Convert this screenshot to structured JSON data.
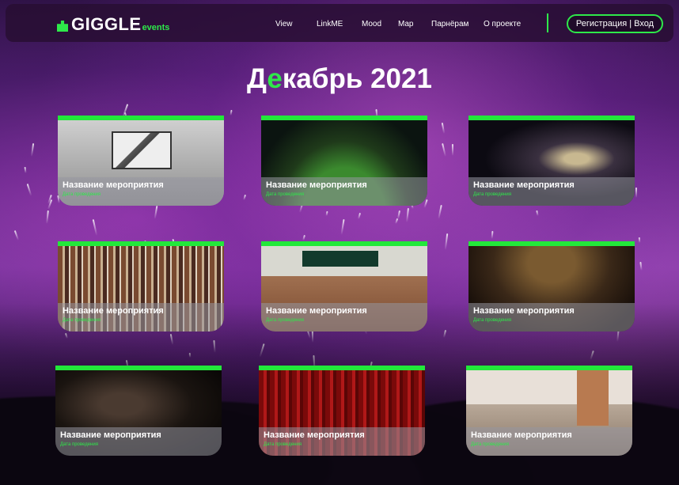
{
  "brand": {
    "name": "GIGGLE",
    "suffix": "events",
    "accent": "#2ee84a"
  },
  "nav": {
    "items": [
      "View",
      "LinkME",
      "Mood",
      "Map",
      "Парнёрам",
      "О проекте"
    ],
    "auth_label": "Регистрация | Вход"
  },
  "page": {
    "title_part1": "Д",
    "title_accent": "е",
    "title_part2": "кабрь 2021"
  },
  "events": [
    {
      "title": "Название мероприятия",
      "date": "Дата проведения"
    },
    {
      "title": "Название мероприятия",
      "date": "Дата проведения"
    },
    {
      "title": "Название мероприятия",
      "date": "Дата проведения"
    },
    {
      "title": "Название мероприятия",
      "date": "Дата проведения"
    },
    {
      "title": "Название мероприятия",
      "date": "Дата проведения"
    },
    {
      "title": "Название мероприятия",
      "date": "Дата проведения"
    },
    {
      "title": "Название мероприятия",
      "date": "Дата проведения"
    },
    {
      "title": "Название мероприятия",
      "date": "Дата проведения"
    },
    {
      "title": "Название мероприятия",
      "date": "Дата проведения"
    }
  ]
}
